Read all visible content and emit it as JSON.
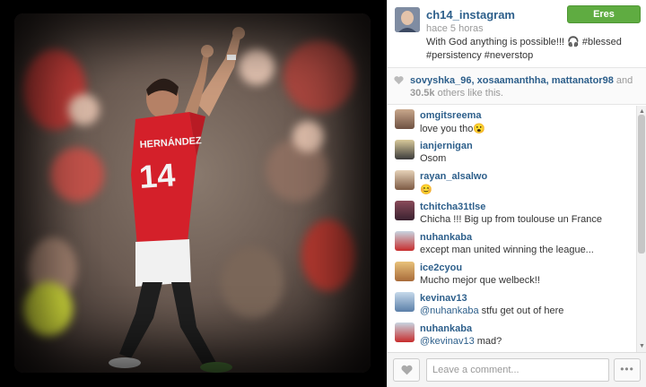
{
  "post": {
    "username": "ch14_instagram",
    "time_ago": "hace 5 horas",
    "caption": "With God anything is possible!!! 🎧 #blessed #persistency #neverstop",
    "follow_label": "Eres seguidor(a)",
    "jersey_name": "HERNÁNDEZ",
    "jersey_number": "14"
  },
  "likes": {
    "names": "sovyshka_96, xosaamanthha, mattanator98",
    "connector": " and ",
    "count": "30.5k",
    "suffix": " others like this."
  },
  "comments": [
    {
      "user": "omgitsreema",
      "text": "love you tho😮"
    },
    {
      "user": "ianjernigan",
      "text": "Osom"
    },
    {
      "user": "rayan_alsalwo",
      "text": "😊"
    },
    {
      "user": "tchitcha31tlse",
      "text": "Chicha !!! Big up from toulouse un France"
    },
    {
      "user": "nuhankaba",
      "text": "except man united winning the league..."
    },
    {
      "user": "ice2cyou",
      "text": "Mucho mejor que welbeck!!"
    },
    {
      "user": "kevinav13",
      "mention": "@nuhankaba",
      "text": " stfu get out of here"
    },
    {
      "user": "nuhankaba",
      "mention": "@kevinav13",
      "text": " mad?"
    }
  ],
  "footer": {
    "comment_placeholder": "Leave a comment...",
    "more_label": "•••"
  },
  "colors": {
    "link": "#2d5f8b",
    "follow_button": "#5fac41",
    "jersey": "#d4202a"
  },
  "icons": [
    "heart-icon",
    "scroll-up-arrow-icon",
    "scroll-down-arrow-icon",
    "more-options-icon"
  ]
}
